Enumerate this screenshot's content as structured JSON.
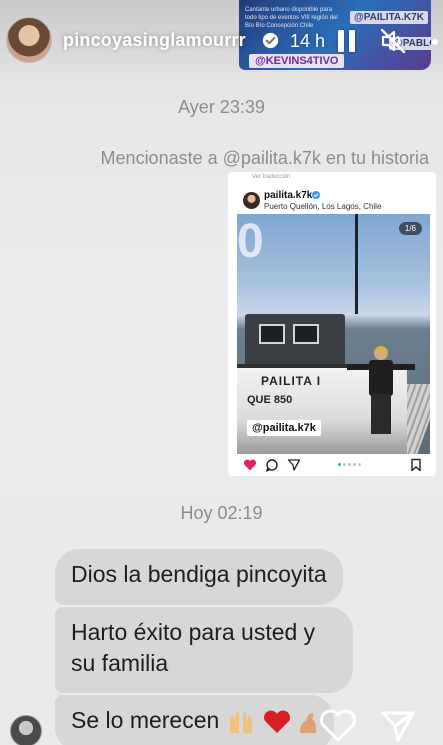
{
  "story_header": {
    "username": "pincoyasinglamourrr",
    "time": "14 h"
  },
  "banner": {
    "text": "Cantante urbano disponible para todo tipo de eventos VIII región del Bío Bío Concepción Chile",
    "tag_1": "@PAILITA.K7K",
    "tag_2": "@PABLO.CL",
    "tag_3": "@KEVINS4TIVO"
  },
  "chat": {
    "stamp_1": "Ayer 23:39",
    "mention_text": "Mencionaste a @pailita.k7k en tu historia",
    "stamp_2": "Hoy 02:19",
    "messages": [
      {
        "text": "Dios la bendiga pincoyita"
      },
      {
        "text": "Harto éxito para usted y su familia"
      },
      {
        "text": "Se lo merecen"
      }
    ]
  },
  "shared_post": {
    "subtop": "Ver traducción",
    "username": "pailita.k7k",
    "location": "Puerto Quellón, Los Lagos, Chile",
    "counter": "1/6",
    "big_glyph": "0",
    "boat_name": "PAILITA I",
    "boat_registration": "QUE 850",
    "photo_tag": "@pailita.k7k"
  },
  "colors": {
    "bubble": "#d7d7d7",
    "system_text": "#8c8c8c",
    "like_red": "#e0245e",
    "verified_blue": "#3897f0"
  },
  "icons": [
    "verified-icon",
    "pause-icon",
    "mute-icon",
    "more-icon",
    "heart-icon",
    "send-icon",
    "comment-icon",
    "bookmark-icon"
  ]
}
